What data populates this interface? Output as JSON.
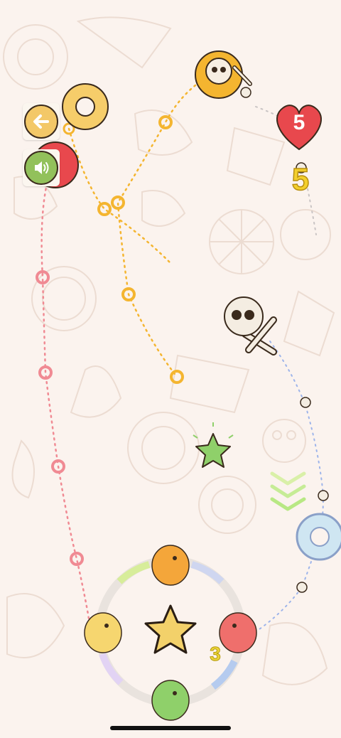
{
  "hud": {
    "back_button": {
      "icon": "arrow-left-icon"
    },
    "sound_button": {
      "icon": "speaker-icon"
    },
    "lives": {
      "value": "5",
      "icon": "heart-icon",
      "color": "#e8484d"
    },
    "score": {
      "value": "5",
      "icon": "skull-icon",
      "color": "#f3cf2c"
    }
  },
  "launcher": {
    "center_icon": "star-icon",
    "ammo_count": "3",
    "dinos": [
      "orange-dino",
      "yellow-dino",
      "red-dino",
      "green-dino"
    ]
  },
  "board": {
    "paths": [
      {
        "name": "pink-path",
        "color": "#f08a93"
      },
      {
        "name": "orange-path",
        "color": "#f4b530"
      },
      {
        "name": "blue-path",
        "color": "#9db4ea"
      }
    ],
    "bonus_item": "green-star",
    "boost_arrows": "double-chevron-down"
  },
  "colors": {
    "background": "#fbf3ee",
    "orange": "#f4b530",
    "pink": "#f08a93",
    "green": "#8fd06a",
    "yellow": "#f3d16a"
  }
}
